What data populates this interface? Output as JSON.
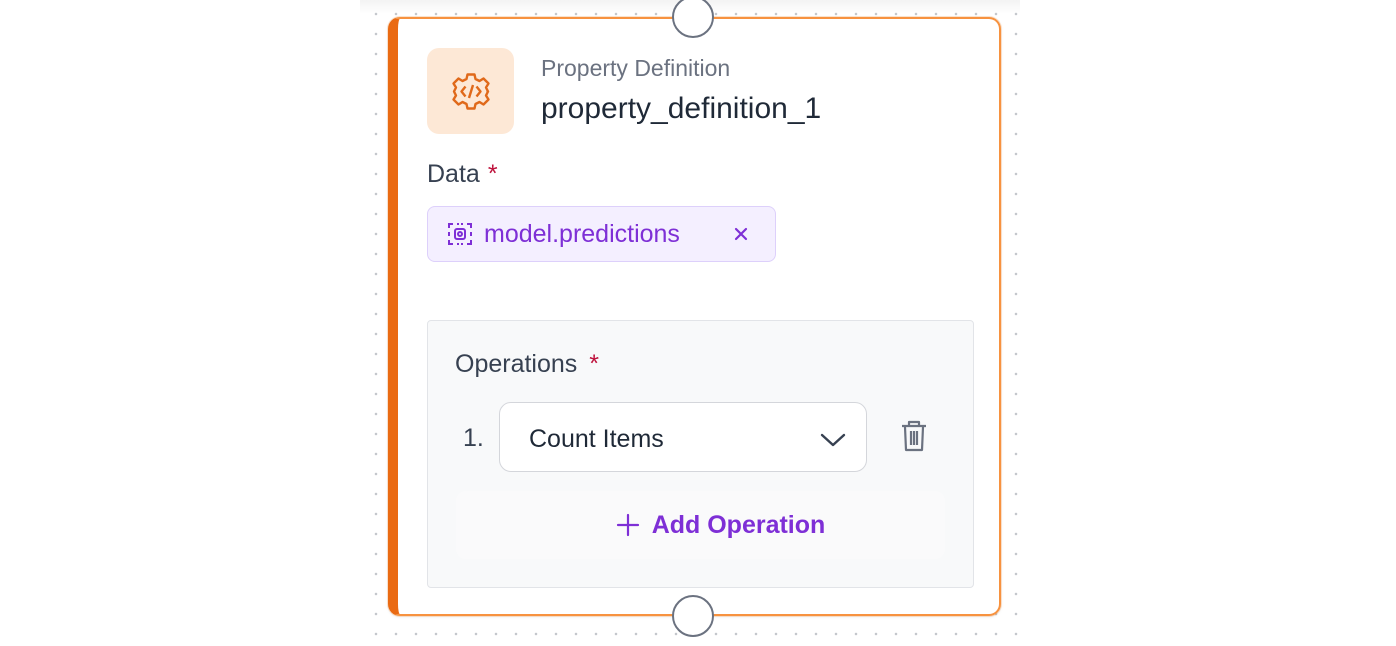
{
  "node": {
    "type_label": "Property Definition",
    "name": "property_definition_1",
    "icon": "code-gear-icon",
    "accent_color": "#ea6a12"
  },
  "data_field": {
    "label": "Data",
    "required_mark": "*",
    "chip": {
      "icon": "variable-icon",
      "text": "model.predictions",
      "remove_glyph": "×"
    }
  },
  "operations": {
    "label": "Operations",
    "required_mark": "*",
    "items": [
      {
        "index": "1.",
        "value": "Count Items"
      }
    ],
    "add_button_label": "Add Operation"
  },
  "colors": {
    "chip_text": "#7e2fd6",
    "required": "#be123c",
    "border": "#f7923f"
  }
}
